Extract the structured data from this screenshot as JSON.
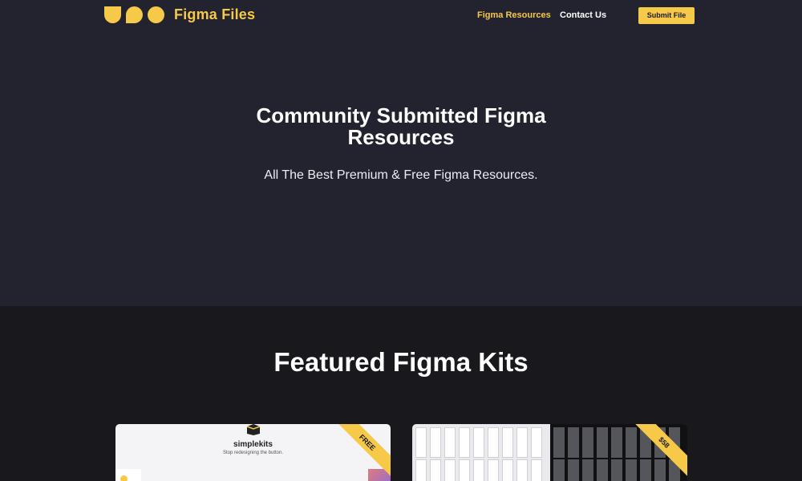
{
  "brand": {
    "name": "Figma Files",
    "accent": "#f7c948"
  },
  "nav": {
    "resources": "Figma Resources",
    "contact": "Contact Us",
    "submit": "Submit File"
  },
  "hero": {
    "title": "Community Submitted Figma Resources",
    "subtitle": "All The Best Premium & Free Figma Resources."
  },
  "featured": {
    "title": "Featured Figma Kits",
    "cards": [
      {
        "ribbon": "FREE",
        "name": "simplekits",
        "tagline": "Stop redesigning the button."
      },
      {
        "ribbon": "$58"
      }
    ]
  },
  "colors": {
    "hero_bg": "#232330",
    "page_bg": "#18181d"
  }
}
